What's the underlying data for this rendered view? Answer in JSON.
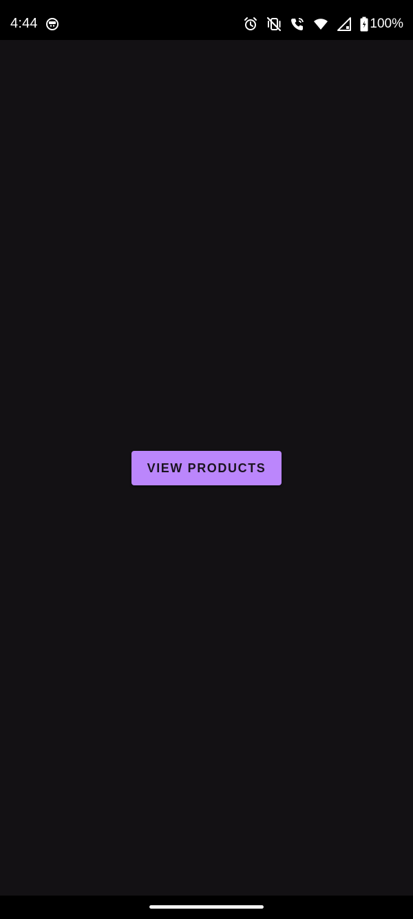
{
  "status_bar": {
    "time": "4:44",
    "left_icon": "notification-app-icon",
    "icons": [
      "alarm-icon",
      "vibrate-off-icon",
      "wifi-calling-icon",
      "wifi-icon",
      "cellular-signal-icon",
      "battery-icon"
    ],
    "battery_percent": "100%"
  },
  "main": {
    "primary_button_label": "VIEW PRODUCTS",
    "background_color": "#131114",
    "accent_color": "#bb86fc"
  },
  "navigation": {
    "gesture_handle": "home-gesture-handle"
  }
}
